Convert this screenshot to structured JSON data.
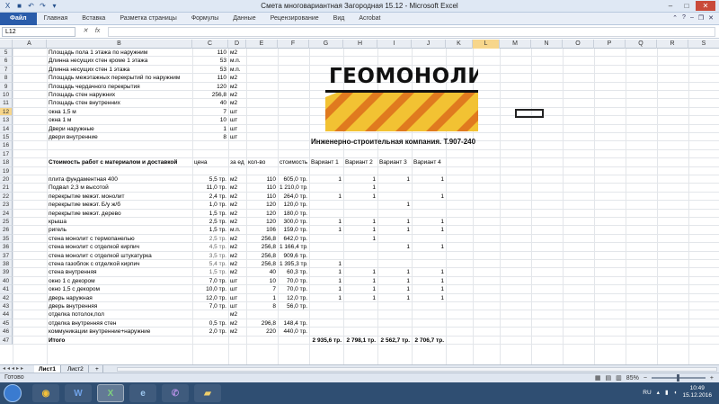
{
  "window": {
    "title": "Смета многовариантная Загородная 15.12  -  Microsoft Excel"
  },
  "ribbon": {
    "tabs": [
      "Файл",
      "Главная",
      "Вставка",
      "Разметка страницы",
      "Формулы",
      "Данные",
      "Рецензирование",
      "Вид",
      "Acrobat"
    ]
  },
  "formula_bar": {
    "name_box": "L12",
    "fx": "fx",
    "value": ""
  },
  "columns": [
    "A",
    "B",
    "C",
    "D",
    "E",
    "F",
    "G",
    "H",
    "I",
    "J",
    "K",
    "L",
    "M",
    "N",
    "O",
    "P",
    "Q",
    "R",
    "S"
  ],
  "selected_column": "L",
  "selected_row": "12",
  "logo": {
    "text": "ГЕОМОНОЛИТ",
    "tagline": "Инженерно-строительная компания. Т.907-240"
  },
  "params": [
    {
      "row": "5",
      "label": "Площадь пола 1 этажа по наружним",
      "value": "110",
      "unit": "м2"
    },
    {
      "row": "6",
      "label": "Длинна несущих стен кроме 1 этажа",
      "value": "53",
      "unit": "м.п."
    },
    {
      "row": "7",
      "label": "Длинна несущих стен 1 этажа",
      "value": "53",
      "unit": "м.п."
    },
    {
      "row": "8",
      "label": "Площадь межэтажных перекрытий по наружним",
      "value": "110",
      "unit": "м2"
    },
    {
      "row": "9",
      "label": "Площадь чердачного перекрытия",
      "value": "120",
      "unit": "м2"
    },
    {
      "row": "10",
      "label": "Площадь стен наружних",
      "value": "256,8",
      "unit": "м2"
    },
    {
      "row": "11",
      "label": "Площадь стен внутренних",
      "value": "40",
      "unit": "м2"
    },
    {
      "row": "12",
      "label": "окна 1,5 м",
      "value": "7",
      "unit": "шт"
    },
    {
      "row": "13",
      "label": "окна 1 м",
      "value": "10",
      "unit": "шт"
    },
    {
      "row": "14",
      "label": "Двери наружные",
      "value": "1",
      "unit": "шт"
    },
    {
      "row": "15",
      "label": "двери внутренние",
      "value": "8",
      "unit": "шт"
    },
    {
      "row": "16",
      "label": "",
      "value": "",
      "unit": ""
    },
    {
      "row": "17",
      "label": "",
      "value": "",
      "unit": ""
    }
  ],
  "table_header": {
    "row": "18",
    "title": "Стоимость работ с материалом и доставкой",
    "price": "цена",
    "unit": "за ед.",
    "qty": "кол-во",
    "cost": "стоимость",
    "v1": "Вариант 1",
    "v2": "Вариант 2",
    "v3": "Вариант 3",
    "v4": "Вариант 4"
  },
  "rows": [
    {
      "row": "19",
      "name": "",
      "price": "",
      "unit": "",
      "qty": "",
      "cost": "",
      "v1": "",
      "v2": "",
      "v3": "",
      "v4": "",
      "grey": false
    },
    {
      "row": "20",
      "name": "плита фундаментная 400",
      "price": "5,5 тр.",
      "unit": "м2",
      "qty": "110",
      "cost": "605,0 тр.",
      "v1": "1",
      "v2": "1",
      "v3": "1",
      "v4": "1",
      "grey": false
    },
    {
      "row": "21",
      "name": "Подвал 2,3 м высотой",
      "price": "11,0 тр.",
      "unit": "м2",
      "qty": "110",
      "cost": "1 210,0 тр.",
      "v1": "",
      "v2": "1",
      "v3": "",
      "v4": "",
      "grey": false
    },
    {
      "row": "22",
      "name": "перекрытие межэт. монолит",
      "price": "2,4 тр.",
      "unit": "м2",
      "qty": "110",
      "cost": "264,0 тр.",
      "v1": "1",
      "v2": "1",
      "v3": "",
      "v4": "1",
      "grey": false
    },
    {
      "row": "23",
      "name": "перекрытие межэт. Б/у ж/б",
      "price": "1,0 тр.",
      "unit": "м2",
      "qty": "120",
      "cost": "120,0 тр.",
      "v1": "",
      "v2": "",
      "v3": "1",
      "v4": "",
      "grey": false
    },
    {
      "row": "24",
      "name": "перекрытие межэт. дерево",
      "price": "1,5 тр.",
      "unit": "м2",
      "qty": "120",
      "cost": "180,0 тр.",
      "v1": "",
      "v2": "",
      "v3": "",
      "v4": "",
      "grey": false
    },
    {
      "row": "25",
      "name": "крыша",
      "price": "2,5 тр.",
      "unit": "м2",
      "qty": "120",
      "cost": "300,0 тр.",
      "v1": "1",
      "v2": "1",
      "v3": "1",
      "v4": "1",
      "grey": false
    },
    {
      "row": "26",
      "name": "ригель",
      "price": "1,5 тр.",
      "unit": "м.п.",
      "qty": "106",
      "cost": "159,0 тр.",
      "v1": "1",
      "v2": "1",
      "v3": "1",
      "v4": "1",
      "grey": false
    },
    {
      "row": "35",
      "name": "стена монолит с термопанелью",
      "price": "2,5 тр.",
      "unit": "м2",
      "qty": "256,8",
      "cost": "642,0 тр.",
      "v1": "",
      "v2": "1",
      "v3": "",
      "v4": "",
      "grey": true
    },
    {
      "row": "36",
      "name": "стена монолит с отделкой кирпич",
      "price": "4,5 тр.",
      "unit": "м2",
      "qty": "256,8",
      "cost": "1 166,4 тр.",
      "v1": "",
      "v2": "",
      "v3": "1",
      "v4": "1",
      "grey": true
    },
    {
      "row": "37",
      "name": "стена монолит с отделкой штукатурка",
      "price": "3,5 тр.",
      "unit": "м2",
      "qty": "256,8",
      "cost": "909,6 тр.",
      "v1": "",
      "v2": "",
      "v3": "",
      "v4": "",
      "grey": true
    },
    {
      "row": "38",
      "name": "стена газоблок с отделкой кирпич",
      "price": "5,4 тр.",
      "unit": "м2",
      "qty": "256,8",
      "cost": "1 395,3 тр.",
      "v1": "1",
      "v2": "",
      "v3": "",
      "v4": "",
      "grey": true
    },
    {
      "row": "39",
      "name": "стена внутренняя",
      "price": "1,5 тр.",
      "unit": "м2",
      "qty": "40",
      "cost": "60,3 тр.",
      "v1": "1",
      "v2": "1",
      "v3": "1",
      "v4": "1",
      "grey": true
    },
    {
      "row": "40",
      "name": "окно 1 с декором",
      "price": "7,0 тр.",
      "unit": "шт",
      "qty": "10",
      "cost": "70,0 тр.",
      "v1": "1",
      "v2": "1",
      "v3": "1",
      "v4": "1",
      "grey": false
    },
    {
      "row": "41",
      "name": "окно 1,5 с декором",
      "price": "10,0 тр.",
      "unit": "шт",
      "qty": "7",
      "cost": "70,0 тр.",
      "v1": "1",
      "v2": "1",
      "v3": "1",
      "v4": "1",
      "grey": false
    },
    {
      "row": "42",
      "name": "дверь наружная",
      "price": "12,0 тр.",
      "unit": "шт",
      "qty": "1",
      "cost": "12,0 тр.",
      "v1": "1",
      "v2": "1",
      "v3": "1",
      "v4": "1",
      "grey": false
    },
    {
      "row": "43",
      "name": "дверь внутренняя",
      "price": "7,0 тр.",
      "unit": "шт",
      "qty": "8",
      "cost": "56,0 тр.",
      "v1": "",
      "v2": "",
      "v3": "",
      "v4": "",
      "grey": false
    },
    {
      "row": "44",
      "name": "отделка потолок,пол",
      "price": "",
      "unit": "м2",
      "qty": "",
      "cost": "",
      "v1": "",
      "v2": "",
      "v3": "",
      "v4": "",
      "grey": false
    },
    {
      "row": "45",
      "name": "отделка внутренняя стен",
      "price": "0,5 тр.",
      "unit": "м2",
      "qty": "296,8",
      "cost": "148,4 тр.",
      "v1": "",
      "v2": "",
      "v3": "",
      "v4": "",
      "grey": false
    },
    {
      "row": "46",
      "name": "коммуникации внутренние+наружние",
      "price": "2,0 тр.",
      "unit": "м2",
      "qty": "220",
      "cost": "440,0 тр.",
      "v1": "",
      "v2": "",
      "v3": "",
      "v4": "",
      "grey": false
    },
    {
      "row": "47",
      "name": "Итого",
      "price": "",
      "unit": "",
      "qty": "",
      "cost": "",
      "v1": "2 935,6 тр.",
      "v2": "2 798,1 тр.",
      "v3": "2 562,7 тр.",
      "v4": "2 706,7 тр.",
      "grey": false,
      "bold": true
    }
  ],
  "sheets": [
    "Лист1",
    "Лист2"
  ],
  "active_sheet": "Лист1",
  "status": {
    "ready": "Готово",
    "zoom": "85%"
  },
  "taskbar": {
    "apps": [
      "chrome-icon",
      "word-icon",
      "excel-icon",
      "explorer-icon",
      "viber-icon",
      "folder-icon"
    ],
    "lang": "RU",
    "time": "10:49",
    "date": "15.12.2016"
  },
  "colors": {
    "file_tab": "#2a5caa",
    "selected_header": "#f7d68b",
    "logo_yellow": "#f2c233",
    "taskbar": "#2f4e72"
  }
}
